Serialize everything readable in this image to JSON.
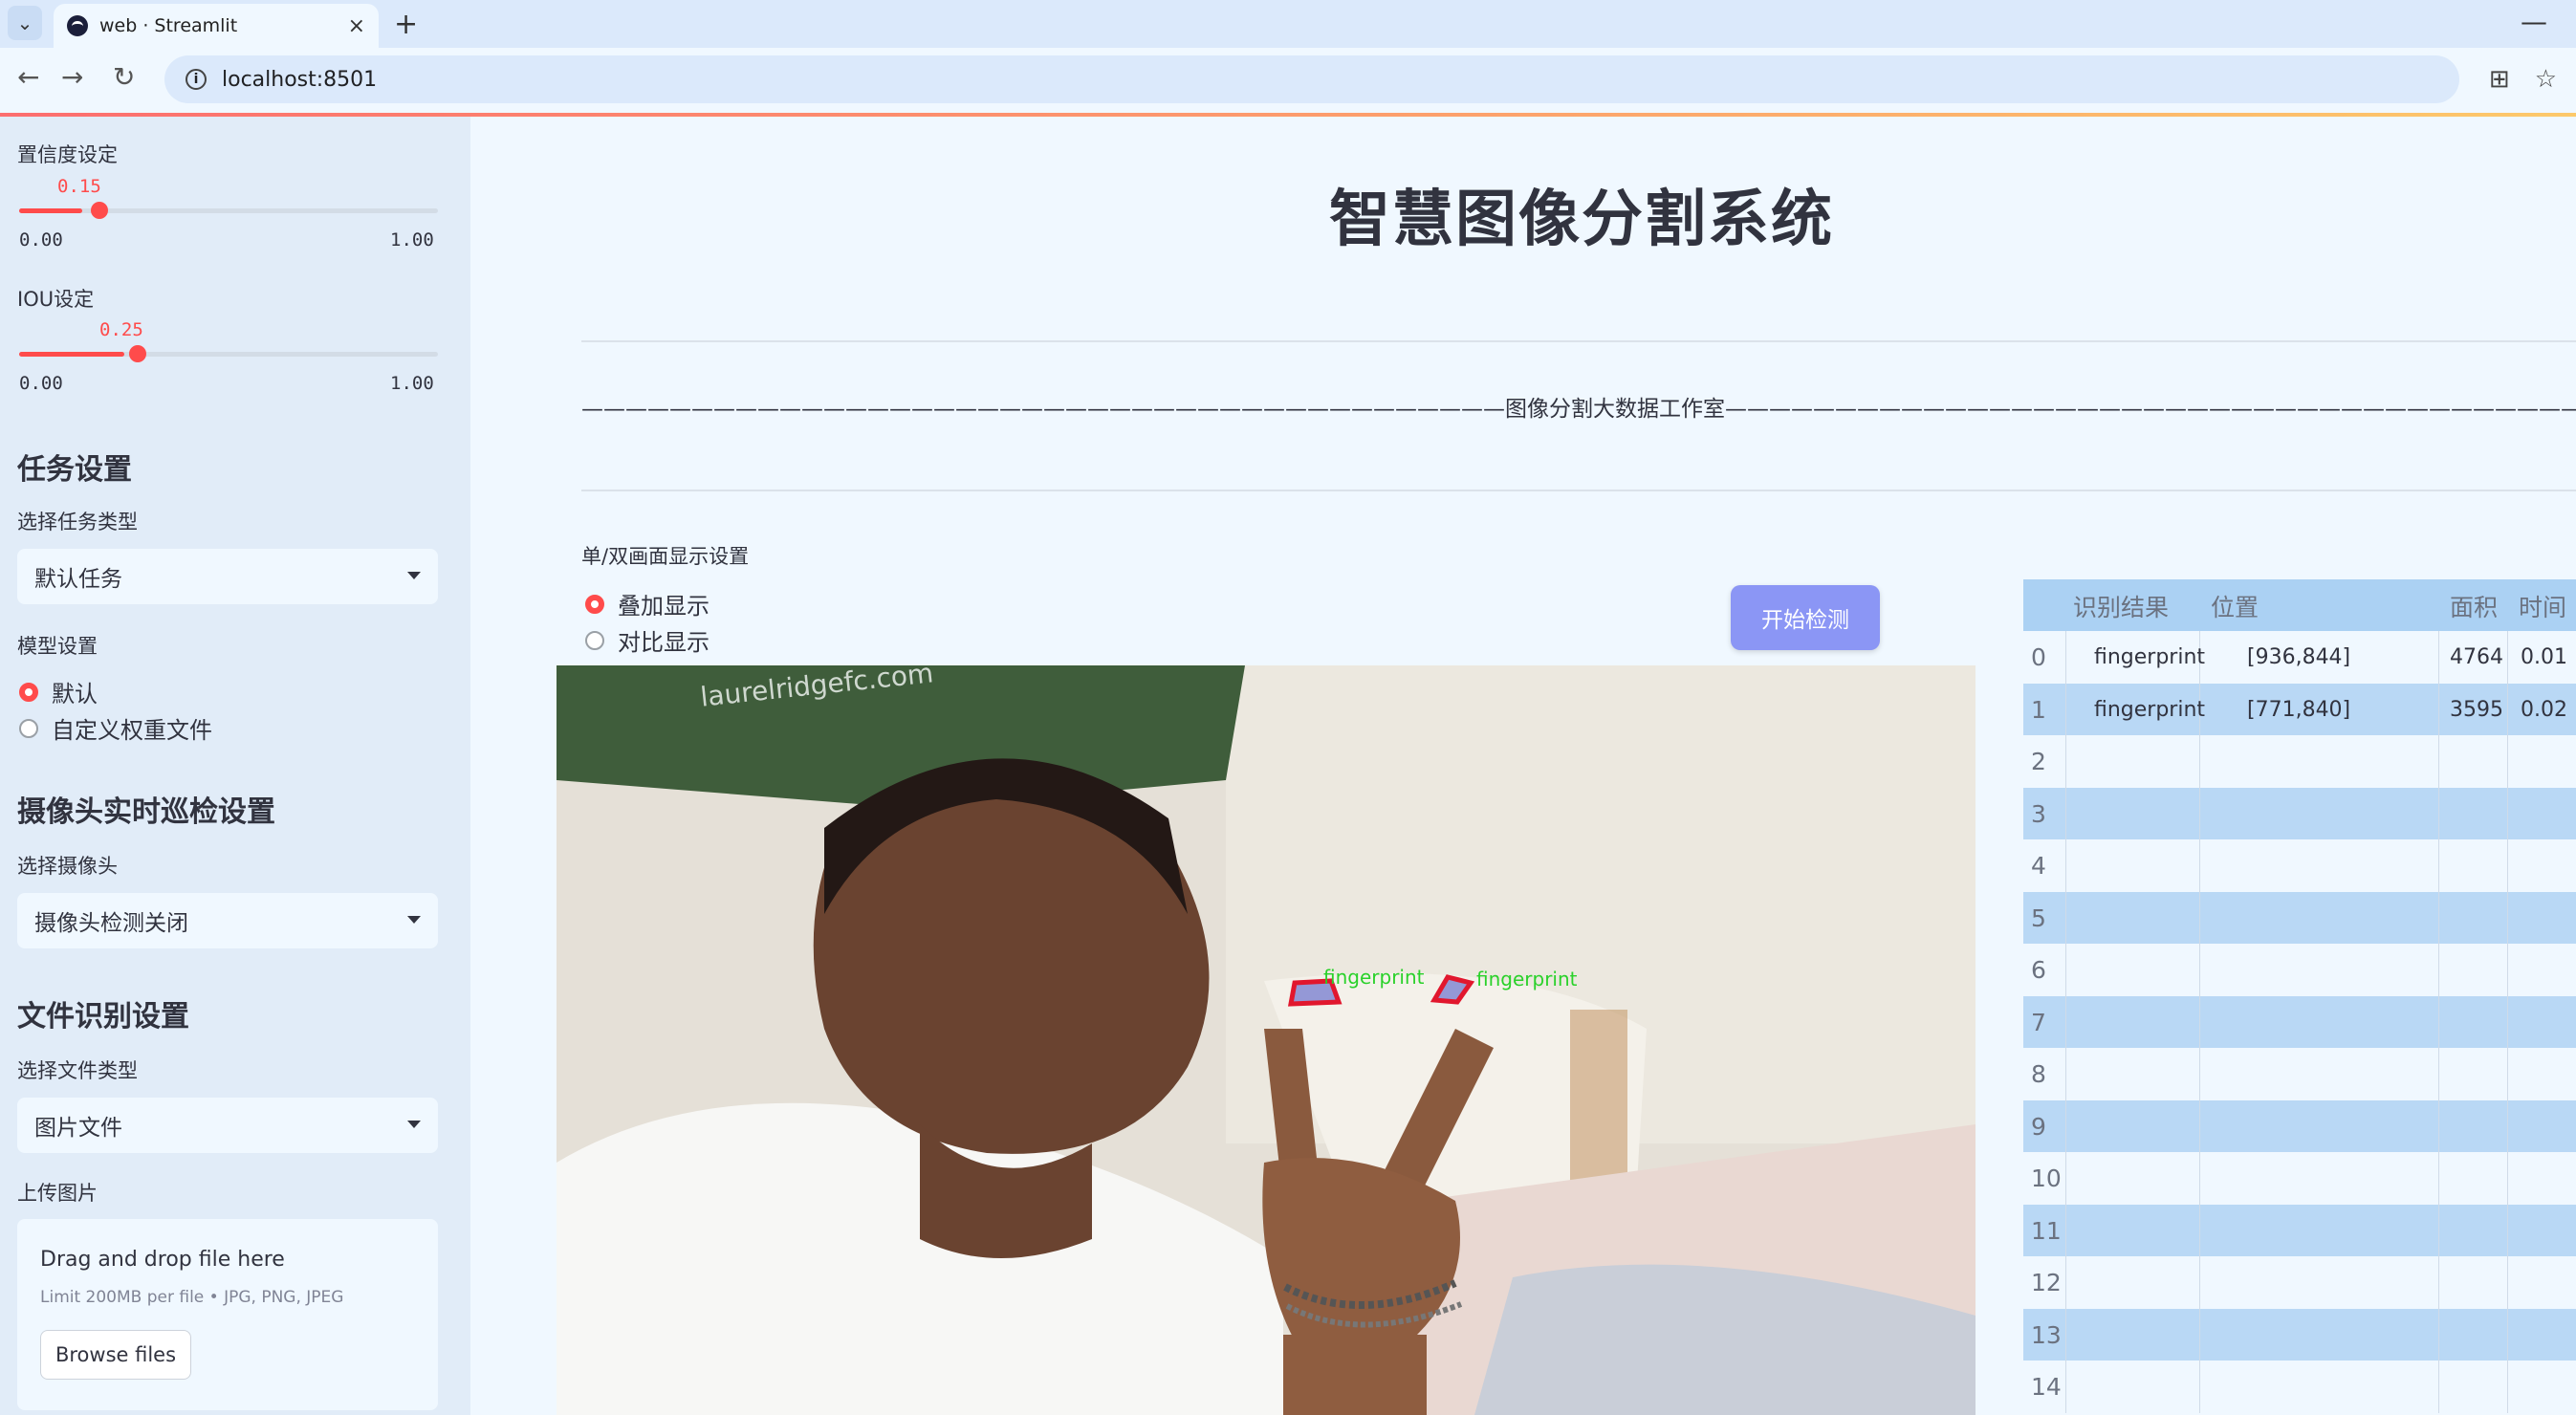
{
  "browser": {
    "tab_title": "web · Streamlit",
    "url": "localhost:8501",
    "new_tab": "+",
    "close": "×",
    "minimize": "—"
  },
  "sidebar": {
    "confidence": {
      "label": "置信度设定",
      "value_text": "0.15",
      "value": 0.15,
      "min": "0.00",
      "max": "1.00"
    },
    "iou": {
      "label": "IOU设定",
      "value_text": "0.25",
      "value": 0.25,
      "min": "0.00",
      "max": "1.00"
    },
    "task_heading": "任务设置",
    "task_type_label": "选择任务类型",
    "task_type_value": "默认任务",
    "model_label": "模型设置",
    "model_options": [
      "默认",
      "自定义权重文件"
    ],
    "model_selected": 0,
    "camera_heading": "摄像头实时巡检设置",
    "camera_label": "选择摄像头",
    "camera_value": "摄像头检测关闭",
    "file_heading": "文件识别设置",
    "file_type_label": "选择文件类型",
    "file_type_value": "图片文件",
    "upload_label": "上传图片",
    "upload_drag": "Drag and drop file here",
    "upload_limit": "Limit 200MB per file • JPG, PNG, JPEG",
    "browse_button": "Browse files"
  },
  "main": {
    "title": "智慧图像分割系统",
    "studio_line": "——————————————————————————————————————————图像分割大数据工作室——————————————————————————————————————————",
    "display_label": "单/双画面显示设置",
    "display_options": [
      "叠加显示",
      "对比显示"
    ],
    "display_selected": 0,
    "start_button": "开始检测",
    "image": {
      "watermark": "laurelridgefc.com",
      "detections": [
        "fingerprint",
        "fingerprint"
      ]
    }
  },
  "results_table": {
    "headers": [
      "",
      "识别结果",
      "位置",
      "面积",
      "时间"
    ],
    "rows": [
      [
        "0",
        "fingerprint",
        "[936,844]",
        "4764",
        "0.01"
      ],
      [
        "1",
        "fingerprint",
        "[771,840]",
        "3595",
        "0.02"
      ],
      [
        "2",
        "",
        "",
        "",
        ""
      ],
      [
        "3",
        "",
        "",
        "",
        ""
      ],
      [
        "4",
        "",
        "",
        "",
        ""
      ],
      [
        "5",
        "",
        "",
        "",
        ""
      ],
      [
        "6",
        "",
        "",
        "",
        ""
      ],
      [
        "7",
        "",
        "",
        "",
        ""
      ],
      [
        "8",
        "",
        "",
        "",
        ""
      ],
      [
        "9",
        "",
        "",
        "",
        ""
      ],
      [
        "10",
        "",
        "",
        "",
        ""
      ],
      [
        "11",
        "",
        "",
        "",
        ""
      ],
      [
        "12",
        "",
        "",
        "",
        ""
      ],
      [
        "13",
        "",
        "",
        "",
        ""
      ],
      [
        "14",
        "",
        "",
        "",
        ""
      ]
    ]
  },
  "colors": {
    "accent": "#ff4b4b",
    "button": "#8b96f5",
    "table_header": "#abd1f3",
    "table_stripe": "#b9d8f5"
  }
}
